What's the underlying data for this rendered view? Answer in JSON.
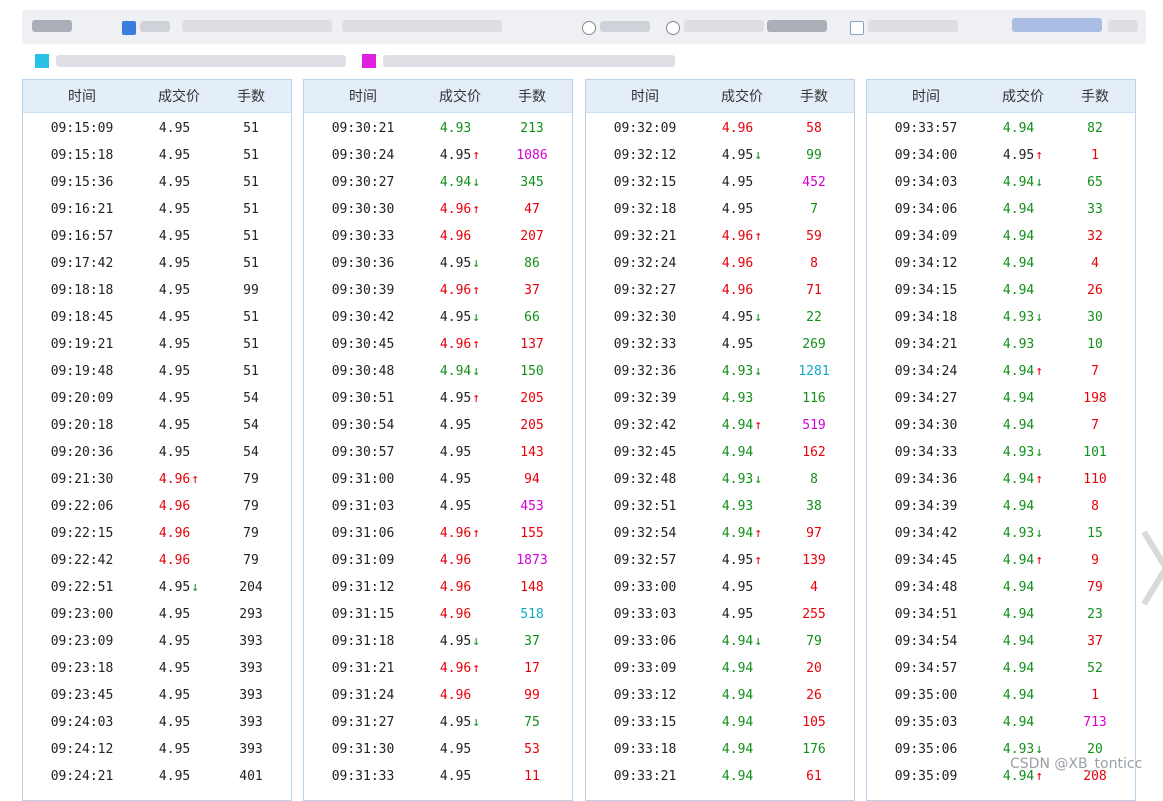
{
  "columns": {
    "time": "时间",
    "price": "成交价",
    "volume": "手数"
  },
  "colors": {
    "red": "#e8000a",
    "green": "#12901a",
    "magenta": "#d400d4",
    "cyan": "#12a8c8",
    "header_bg": "#e3eef8"
  },
  "watermark": "CSDN @XB_tonticc",
  "panels": [
    {
      "rows": [
        {
          "t": "09:15:09",
          "p": "4.95",
          "pc": "blk",
          "a": "",
          "v": "51",
          "vc": "blk"
        },
        {
          "t": "09:15:18",
          "p": "4.95",
          "pc": "blk",
          "a": "",
          "v": "51",
          "vc": "blk"
        },
        {
          "t": "09:15:36",
          "p": "4.95",
          "pc": "blk",
          "a": "",
          "v": "51",
          "vc": "blk"
        },
        {
          "t": "09:16:21",
          "p": "4.95",
          "pc": "blk",
          "a": "",
          "v": "51",
          "vc": "blk"
        },
        {
          "t": "09:16:57",
          "p": "4.95",
          "pc": "blk",
          "a": "",
          "v": "51",
          "vc": "blk"
        },
        {
          "t": "09:17:42",
          "p": "4.95",
          "pc": "blk",
          "a": "",
          "v": "51",
          "vc": "blk"
        },
        {
          "t": "09:18:18",
          "p": "4.95",
          "pc": "blk",
          "a": "",
          "v": "99",
          "vc": "blk"
        },
        {
          "t": "09:18:45",
          "p": "4.95",
          "pc": "blk",
          "a": "",
          "v": "51",
          "vc": "blk"
        },
        {
          "t": "09:19:21",
          "p": "4.95",
          "pc": "blk",
          "a": "",
          "v": "51",
          "vc": "blk"
        },
        {
          "t": "09:19:48",
          "p": "4.95",
          "pc": "blk",
          "a": "",
          "v": "51",
          "vc": "blk"
        },
        {
          "t": "09:20:09",
          "p": "4.95",
          "pc": "blk",
          "a": "",
          "v": "54",
          "vc": "blk"
        },
        {
          "t": "09:20:18",
          "p": "4.95",
          "pc": "blk",
          "a": "",
          "v": "54",
          "vc": "blk"
        },
        {
          "t": "09:20:36",
          "p": "4.95",
          "pc": "blk",
          "a": "",
          "v": "54",
          "vc": "blk"
        },
        {
          "t": "09:21:30",
          "p": "4.96",
          "pc": "red",
          "a": "up",
          "v": "79",
          "vc": "blk"
        },
        {
          "t": "09:22:06",
          "p": "4.96",
          "pc": "red",
          "a": "",
          "v": "79",
          "vc": "blk"
        },
        {
          "t": "09:22:15",
          "p": "4.96",
          "pc": "red",
          "a": "",
          "v": "79",
          "vc": "blk"
        },
        {
          "t": "09:22:42",
          "p": "4.96",
          "pc": "red",
          "a": "",
          "v": "79",
          "vc": "blk"
        },
        {
          "t": "09:22:51",
          "p": "4.95",
          "pc": "blk",
          "a": "down",
          "v": "204",
          "vc": "blk"
        },
        {
          "t": "09:23:00",
          "p": "4.95",
          "pc": "blk",
          "a": "",
          "v": "293",
          "vc": "blk"
        },
        {
          "t": "09:23:09",
          "p": "4.95",
          "pc": "blk",
          "a": "",
          "v": "393",
          "vc": "blk"
        },
        {
          "t": "09:23:18",
          "p": "4.95",
          "pc": "blk",
          "a": "",
          "v": "393",
          "vc": "blk"
        },
        {
          "t": "09:23:45",
          "p": "4.95",
          "pc": "blk",
          "a": "",
          "v": "393",
          "vc": "blk"
        },
        {
          "t": "09:24:03",
          "p": "4.95",
          "pc": "blk",
          "a": "",
          "v": "393",
          "vc": "blk"
        },
        {
          "t": "09:24:12",
          "p": "4.95",
          "pc": "blk",
          "a": "",
          "v": "393",
          "vc": "blk"
        },
        {
          "t": "09:24:21",
          "p": "4.95",
          "pc": "blk",
          "a": "",
          "v": "401",
          "vc": "blk"
        }
      ]
    },
    {
      "rows": [
        {
          "t": "09:30:21",
          "p": "4.93",
          "pc": "green",
          "a": "",
          "v": "213",
          "vc": "green"
        },
        {
          "t": "09:30:24",
          "p": "4.95",
          "pc": "blk",
          "a": "up",
          "v": "1086",
          "vc": "mag"
        },
        {
          "t": "09:30:27",
          "p": "4.94",
          "pc": "green",
          "a": "down",
          "v": "345",
          "vc": "green"
        },
        {
          "t": "09:30:30",
          "p": "4.96",
          "pc": "red",
          "a": "up",
          "v": "47",
          "vc": "red"
        },
        {
          "t": "09:30:33",
          "p": "4.96",
          "pc": "red",
          "a": "",
          "v": "207",
          "vc": "red"
        },
        {
          "t": "09:30:36",
          "p": "4.95",
          "pc": "blk",
          "a": "down",
          "v": "86",
          "vc": "green"
        },
        {
          "t": "09:30:39",
          "p": "4.96",
          "pc": "red",
          "a": "up",
          "v": "37",
          "vc": "red"
        },
        {
          "t": "09:30:42",
          "p": "4.95",
          "pc": "blk",
          "a": "down",
          "v": "66",
          "vc": "green"
        },
        {
          "t": "09:30:45",
          "p": "4.96",
          "pc": "red",
          "a": "up",
          "v": "137",
          "vc": "red"
        },
        {
          "t": "09:30:48",
          "p": "4.94",
          "pc": "green",
          "a": "down",
          "v": "150",
          "vc": "green"
        },
        {
          "t": "09:30:51",
          "p": "4.95",
          "pc": "blk",
          "a": "up",
          "v": "205",
          "vc": "red"
        },
        {
          "t": "09:30:54",
          "p": "4.95",
          "pc": "blk",
          "a": "",
          "v": "205",
          "vc": "red"
        },
        {
          "t": "09:30:57",
          "p": "4.95",
          "pc": "blk",
          "a": "",
          "v": "143",
          "vc": "red"
        },
        {
          "t": "09:31:00",
          "p": "4.95",
          "pc": "blk",
          "a": "",
          "v": "94",
          "vc": "red"
        },
        {
          "t": "09:31:03",
          "p": "4.95",
          "pc": "blk",
          "a": "",
          "v": "453",
          "vc": "mag"
        },
        {
          "t": "09:31:06",
          "p": "4.96",
          "pc": "red",
          "a": "up",
          "v": "155",
          "vc": "red"
        },
        {
          "t": "09:31:09",
          "p": "4.96",
          "pc": "red",
          "a": "",
          "v": "1873",
          "vc": "mag"
        },
        {
          "t": "09:31:12",
          "p": "4.96",
          "pc": "red",
          "a": "",
          "v": "148",
          "vc": "red"
        },
        {
          "t": "09:31:15",
          "p": "4.96",
          "pc": "red",
          "a": "",
          "v": "518",
          "vc": "cyan"
        },
        {
          "t": "09:31:18",
          "p": "4.95",
          "pc": "blk",
          "a": "down",
          "v": "37",
          "vc": "green"
        },
        {
          "t": "09:31:21",
          "p": "4.96",
          "pc": "red",
          "a": "up",
          "v": "17",
          "vc": "red"
        },
        {
          "t": "09:31:24",
          "p": "4.96",
          "pc": "red",
          "a": "",
          "v": "99",
          "vc": "red"
        },
        {
          "t": "09:31:27",
          "p": "4.95",
          "pc": "blk",
          "a": "down",
          "v": "75",
          "vc": "green"
        },
        {
          "t": "09:31:30",
          "p": "4.95",
          "pc": "blk",
          "a": "",
          "v": "53",
          "vc": "red"
        },
        {
          "t": "09:31:33",
          "p": "4.95",
          "pc": "blk",
          "a": "",
          "v": "11",
          "vc": "red"
        }
      ]
    },
    {
      "rows": [
        {
          "t": "09:32:09",
          "p": "4.96",
          "pc": "red",
          "a": "",
          "v": "58",
          "vc": "red"
        },
        {
          "t": "09:32:12",
          "p": "4.95",
          "pc": "blk",
          "a": "down",
          "v": "99",
          "vc": "green"
        },
        {
          "t": "09:32:15",
          "p": "4.95",
          "pc": "blk",
          "a": "",
          "v": "452",
          "vc": "mag"
        },
        {
          "t": "09:32:18",
          "p": "4.95",
          "pc": "blk",
          "a": "",
          "v": "7",
          "vc": "green"
        },
        {
          "t": "09:32:21",
          "p": "4.96",
          "pc": "red",
          "a": "up",
          "v": "59",
          "vc": "red"
        },
        {
          "t": "09:32:24",
          "p": "4.96",
          "pc": "red",
          "a": "",
          "v": "8",
          "vc": "red"
        },
        {
          "t": "09:32:27",
          "p": "4.96",
          "pc": "red",
          "a": "",
          "v": "71",
          "vc": "red"
        },
        {
          "t": "09:32:30",
          "p": "4.95",
          "pc": "blk",
          "a": "down",
          "v": "22",
          "vc": "green"
        },
        {
          "t": "09:32:33",
          "p": "4.95",
          "pc": "blk",
          "a": "",
          "v": "269",
          "vc": "green"
        },
        {
          "t": "09:32:36",
          "p": "4.93",
          "pc": "green",
          "a": "down",
          "v": "1281",
          "vc": "cyan"
        },
        {
          "t": "09:32:39",
          "p": "4.93",
          "pc": "green",
          "a": "",
          "v": "116",
          "vc": "green"
        },
        {
          "t": "09:32:42",
          "p": "4.94",
          "pc": "green",
          "a": "up",
          "v": "519",
          "vc": "mag"
        },
        {
          "t": "09:32:45",
          "p": "4.94",
          "pc": "green",
          "a": "",
          "v": "162",
          "vc": "red"
        },
        {
          "t": "09:32:48",
          "p": "4.93",
          "pc": "green",
          "a": "down",
          "v": "8",
          "vc": "green"
        },
        {
          "t": "09:32:51",
          "p": "4.93",
          "pc": "green",
          "a": "",
          "v": "38",
          "vc": "green"
        },
        {
          "t": "09:32:54",
          "p": "4.94",
          "pc": "green",
          "a": "up",
          "v": "97",
          "vc": "red"
        },
        {
          "t": "09:32:57",
          "p": "4.95",
          "pc": "blk",
          "a": "up",
          "v": "139",
          "vc": "red"
        },
        {
          "t": "09:33:00",
          "p": "4.95",
          "pc": "blk",
          "a": "",
          "v": "4",
          "vc": "red"
        },
        {
          "t": "09:33:03",
          "p": "4.95",
          "pc": "blk",
          "a": "",
          "v": "255",
          "vc": "red"
        },
        {
          "t": "09:33:06",
          "p": "4.94",
          "pc": "green",
          "a": "down",
          "v": "79",
          "vc": "green"
        },
        {
          "t": "09:33:09",
          "p": "4.94",
          "pc": "green",
          "a": "",
          "v": "20",
          "vc": "red"
        },
        {
          "t": "09:33:12",
          "p": "4.94",
          "pc": "green",
          "a": "",
          "v": "26",
          "vc": "red"
        },
        {
          "t": "09:33:15",
          "p": "4.94",
          "pc": "green",
          "a": "",
          "v": "105",
          "vc": "red"
        },
        {
          "t": "09:33:18",
          "p": "4.94",
          "pc": "green",
          "a": "",
          "v": "176",
          "vc": "green"
        },
        {
          "t": "09:33:21",
          "p": "4.94",
          "pc": "green",
          "a": "",
          "v": "61",
          "vc": "red"
        }
      ]
    },
    {
      "rows": [
        {
          "t": "09:33:57",
          "p": "4.94",
          "pc": "green",
          "a": "",
          "v": "82",
          "vc": "green"
        },
        {
          "t": "09:34:00",
          "p": "4.95",
          "pc": "blk",
          "a": "up",
          "v": "1",
          "vc": "red"
        },
        {
          "t": "09:34:03",
          "p": "4.94",
          "pc": "green",
          "a": "down",
          "v": "65",
          "vc": "green"
        },
        {
          "t": "09:34:06",
          "p": "4.94",
          "pc": "green",
          "a": "",
          "v": "33",
          "vc": "green"
        },
        {
          "t": "09:34:09",
          "p": "4.94",
          "pc": "green",
          "a": "",
          "v": "32",
          "vc": "red"
        },
        {
          "t": "09:34:12",
          "p": "4.94",
          "pc": "green",
          "a": "",
          "v": "4",
          "vc": "red"
        },
        {
          "t": "09:34:15",
          "p": "4.94",
          "pc": "green",
          "a": "",
          "v": "26",
          "vc": "red"
        },
        {
          "t": "09:34:18",
          "p": "4.93",
          "pc": "green",
          "a": "down",
          "v": "30",
          "vc": "green"
        },
        {
          "t": "09:34:21",
          "p": "4.93",
          "pc": "green",
          "a": "",
          "v": "10",
          "vc": "green"
        },
        {
          "t": "09:34:24",
          "p": "4.94",
          "pc": "green",
          "a": "up",
          "v": "7",
          "vc": "red"
        },
        {
          "t": "09:34:27",
          "p": "4.94",
          "pc": "green",
          "a": "",
          "v": "198",
          "vc": "red"
        },
        {
          "t": "09:34:30",
          "p": "4.94",
          "pc": "green",
          "a": "",
          "v": "7",
          "vc": "red"
        },
        {
          "t": "09:34:33",
          "p": "4.93",
          "pc": "green",
          "a": "down",
          "v": "101",
          "vc": "green"
        },
        {
          "t": "09:34:36",
          "p": "4.94",
          "pc": "green",
          "a": "up",
          "v": "110",
          "vc": "red"
        },
        {
          "t": "09:34:39",
          "p": "4.94",
          "pc": "green",
          "a": "",
          "v": "8",
          "vc": "red"
        },
        {
          "t": "09:34:42",
          "p": "4.93",
          "pc": "green",
          "a": "down",
          "v": "15",
          "vc": "green"
        },
        {
          "t": "09:34:45",
          "p": "4.94",
          "pc": "green",
          "a": "up",
          "v": "9",
          "vc": "red"
        },
        {
          "t": "09:34:48",
          "p": "4.94",
          "pc": "green",
          "a": "",
          "v": "79",
          "vc": "red"
        },
        {
          "t": "09:34:51",
          "p": "4.94",
          "pc": "green",
          "a": "",
          "v": "23",
          "vc": "green"
        },
        {
          "t": "09:34:54",
          "p": "4.94",
          "pc": "green",
          "a": "",
          "v": "37",
          "vc": "red"
        },
        {
          "t": "09:34:57",
          "p": "4.94",
          "pc": "green",
          "a": "",
          "v": "52",
          "vc": "green"
        },
        {
          "t": "09:35:00",
          "p": "4.94",
          "pc": "green",
          "a": "",
          "v": "1",
          "vc": "red"
        },
        {
          "t": "09:35:03",
          "p": "4.94",
          "pc": "green",
          "a": "",
          "v": "713",
          "vc": "mag"
        },
        {
          "t": "09:35:06",
          "p": "4.93",
          "pc": "green",
          "a": "down",
          "v": "20",
          "vc": "green"
        },
        {
          "t": "09:35:09",
          "p": "4.94",
          "pc": "green",
          "a": "up",
          "v": "208",
          "vc": "red"
        }
      ]
    }
  ]
}
